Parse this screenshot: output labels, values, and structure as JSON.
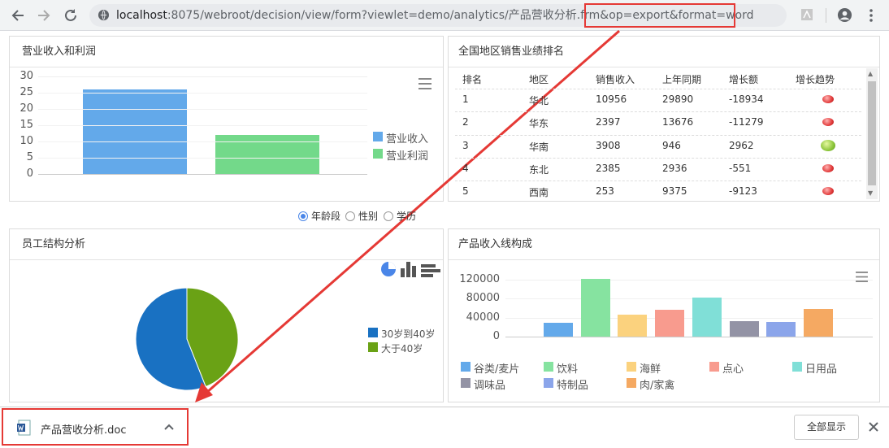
{
  "browser": {
    "url_host": "localhost",
    "url_rest": ":8075/webroot/decision/view/form?viewlet=demo/analytics/产品营收分析.frm&op=export&format=word"
  },
  "panels": {
    "revenue": {
      "title": "营业收入和利润"
    },
    "ranking": {
      "title": "全国地区销售业绩排名"
    },
    "staff": {
      "title": "员工结构分析"
    },
    "product": {
      "title": "产品收入线构成"
    }
  },
  "ranking_table": {
    "headers": [
      "排名",
      "地区",
      "销售收入",
      "上年同期",
      "增长额",
      "增长趋势"
    ],
    "rows": [
      {
        "rank": "1",
        "region": "华北",
        "sales": "10956",
        "last": "29890",
        "growth": "-18934",
        "trend": "down"
      },
      {
        "rank": "2",
        "region": "华东",
        "sales": "2397",
        "last": "13676",
        "growth": "-11279",
        "trend": "down"
      },
      {
        "rank": "3",
        "region": "华南",
        "sales": "3908",
        "last": "946",
        "growth": "2962",
        "trend": "up"
      },
      {
        "rank": "4",
        "region": "东北",
        "sales": "2385",
        "last": "2936",
        "growth": "-551",
        "trend": "down"
      },
      {
        "rank": "5",
        "region": "西南",
        "sales": "253",
        "last": "9375",
        "growth": "-9123",
        "trend": "down"
      }
    ]
  },
  "radio": {
    "options": [
      "年龄段",
      "性别",
      "学历"
    ],
    "selected": 0
  },
  "download": {
    "filename": "产品营收分析.doc",
    "show_all": "全部显示"
  },
  "colors": {
    "accent": "#e53935",
    "blue": "#4a86e8"
  },
  "chart_data": [
    {
      "type": "bar",
      "categories": [
        "",
        ""
      ],
      "series": [
        {
          "name": "营业收入",
          "values": [
            26
          ]
        },
        {
          "name": "营业利润",
          "values": [
            12
          ]
        }
      ],
      "values": [
        26,
        12
      ],
      "colors": [
        "#63a9ea",
        "#73d98a"
      ],
      "yticks": [
        "30",
        "25",
        "20",
        "15",
        "10",
        "5",
        "0"
      ],
      "ylim": [
        0,
        30
      ],
      "title": "营业收入和利润",
      "legend": "right"
    },
    {
      "type": "pie",
      "slices": [
        {
          "name": "30岁到40岁",
          "value": 56,
          "color": "#1971c2"
        },
        {
          "name": "大于40岁",
          "value": 44,
          "color": "#6aa215"
        }
      ],
      "title": "员工结构分析",
      "legend": "right"
    },
    {
      "type": "bar",
      "categories": [
        "谷类/麦片",
        "饮料",
        "海鲜",
        "点心",
        "日用品",
        "调味品",
        "特制品",
        "肉/家禽"
      ],
      "values": [
        30000,
        122000,
        47000,
        57000,
        83000,
        33000,
        31000,
        59000
      ],
      "colors": [
        "#63a9ea",
        "#86e3a0",
        "#fbd27e",
        "#f89b8e",
        "#80dfd7",
        "#9393a5",
        "#8ba5ea",
        "#f5a962"
      ],
      "yticks": [
        "120000",
        "80000",
        "40000",
        "0"
      ],
      "ylim": [
        0,
        120000
      ],
      "title": "产品收入线构成",
      "legend": "bottom"
    }
  ]
}
